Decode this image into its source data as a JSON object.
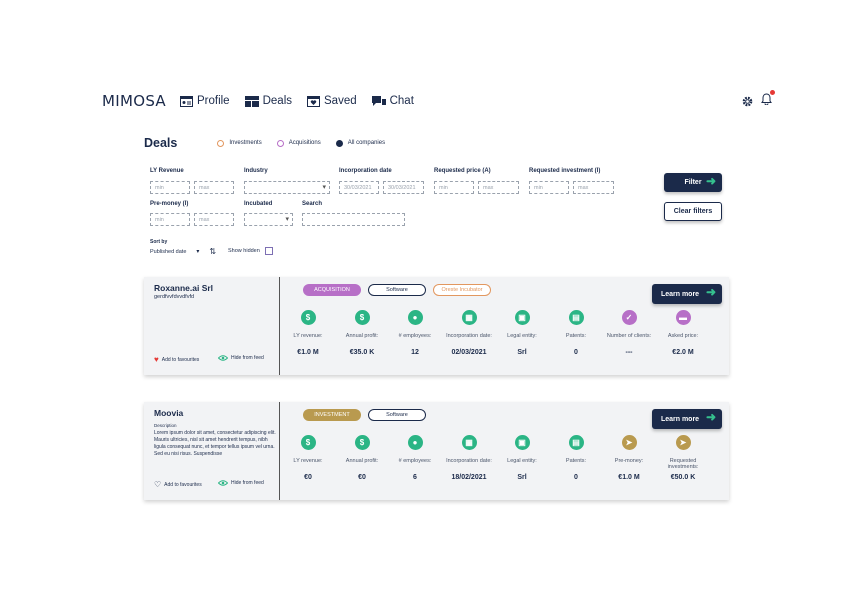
{
  "brand": "MIMOSA",
  "nav": {
    "profile": "Profile",
    "deals": "Deals",
    "saved": "Saved",
    "chat": "Chat"
  },
  "page": {
    "title": "Deals",
    "filter_types": [
      "Investments",
      "Acquisitions",
      "All companies"
    ],
    "selected_type": "All companies"
  },
  "filters": {
    "ly_revenue": {
      "label": "LY Revenue",
      "min": "min",
      "max": "max"
    },
    "industry": {
      "label": "Industry",
      "value": ""
    },
    "incorporation_date": {
      "label": "Incorporation date",
      "from": "30/03/2021",
      "to": "30/03/2021"
    },
    "requested_price": {
      "label": "Requested price (A)",
      "min": "min",
      "max": "max"
    },
    "requested_investment": {
      "label": "Requested investment (I)",
      "min": "min",
      "max": "max"
    },
    "pre_money": {
      "label": "Pre-money (I)",
      "min": "min",
      "max": "max"
    },
    "incubated": {
      "label": "Incubated",
      "value": ""
    },
    "search": {
      "label": "Search",
      "value": ""
    },
    "filter_button": "Filter",
    "clear_button": "Clear filters"
  },
  "sort": {
    "label": "Sort by",
    "value": "Published date",
    "show_hidden": "Show hidden"
  },
  "cards": [
    {
      "name": "Roxanne.ai Srl",
      "subtitle": "gerdfvvfdvvdfvfd",
      "tags": [
        "ACQUISITION",
        "Software",
        "Oreste Incubator"
      ],
      "favourite": "Add to favourites",
      "hide": "Hide from feed",
      "learn_more": "Learn more",
      "metrics": [
        {
          "label": "LY revenue:",
          "value": "€1.0 M",
          "icon": "dollar-icon"
        },
        {
          "label": "Annual profit:",
          "value": "€35.0 K",
          "icon": "dollar-icon"
        },
        {
          "label": "# employees:",
          "value": "12",
          "icon": "people-icon"
        },
        {
          "label": "Incorporation date:",
          "value": "02/03/2021",
          "icon": "calendar-icon"
        },
        {
          "label": "Legal entity:",
          "value": "Srl",
          "icon": "building-icon"
        },
        {
          "label": "Patents:",
          "value": "0",
          "icon": "document-icon"
        },
        {
          "label": "Number of clients:",
          "value": "---",
          "icon": "handshake-icon"
        },
        {
          "label": "Asked price:",
          "value": "€2.0 M",
          "icon": "card-icon"
        }
      ]
    },
    {
      "name": "Moovia",
      "description_label": "Description",
      "description": "Lorem ipsum dolor sit amet, consectetur adipiscing elit. Mauris ultricies, nisl sit amet hendrerit tempus, nibh ligula consequat nunc, et tempor tellus ipsum vel urna. Sed eu nisi risus. Suspendisse",
      "tags": [
        "INVESTMENT",
        "Software"
      ],
      "favourite": "Add to favourites",
      "hide": "Hide from feed",
      "learn_more": "Learn more",
      "metrics": [
        {
          "label": "LY revenue:",
          "value": "€0",
          "icon": "dollar-icon"
        },
        {
          "label": "Annual profit:",
          "value": "€0",
          "icon": "dollar-icon"
        },
        {
          "label": "# employees:",
          "value": "6",
          "icon": "people-icon"
        },
        {
          "label": "Incorporation date:",
          "value": "18/02/2021",
          "icon": "calendar-icon"
        },
        {
          "label": "Legal entity:",
          "value": "Srl",
          "icon": "building-icon"
        },
        {
          "label": "Patents:",
          "value": "0",
          "icon": "document-icon"
        },
        {
          "label": "Pre-money:",
          "value": "€1.0 M",
          "icon": "rocket-icon"
        },
        {
          "label": "Requested investments:",
          "value": "€50.0 K",
          "icon": "rocket-icon"
        }
      ]
    }
  ],
  "colors": {
    "navy": "#1b2a4a",
    "green": "#2bb585",
    "purple": "#b76fc7",
    "gold": "#b99a4f",
    "orange": "#e2975f"
  }
}
